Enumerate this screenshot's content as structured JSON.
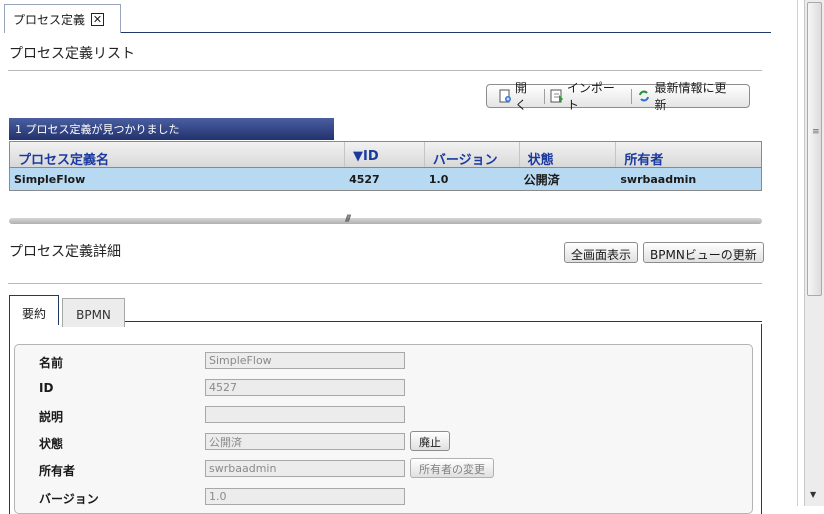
{
  "tab": {
    "title": "プロセス定義"
  },
  "list_section": {
    "title": "プロセス定義リスト"
  },
  "toolbar": {
    "open_label": "開く",
    "import_label": "インポート",
    "refresh_label": "最新情報に更新"
  },
  "result_banner": "1 プロセス定義が見つかりました",
  "table": {
    "columns": [
      "プロセス定義名",
      "▼ID",
      "バージョン",
      "状態",
      "所有者"
    ],
    "rows": [
      {
        "name": "SimpleFlow",
        "id": "4527",
        "version": "1.0",
        "status": "公開済",
        "owner": "swrbaadmin"
      }
    ]
  },
  "detail_section": {
    "title": "プロセス定義詳細",
    "fullscreen_label": "全画面表示",
    "bpmn_refresh_label": "BPMNビューの更新"
  },
  "detail_tabs": [
    "要約",
    "BPMN"
  ],
  "form": {
    "name_label": "名前",
    "name_value": "SimpleFlow",
    "id_label": "ID",
    "id_value": "4527",
    "desc_label": "説明",
    "desc_value": "",
    "status_label": "状態",
    "status_value": "公開済",
    "deprecate_label": "廃止",
    "owner_label": "所有者",
    "owner_value": "swrbaadmin",
    "change_owner_label": "所有者の変更",
    "version_label": "バージョン",
    "version_value": "1.0"
  },
  "colors": {
    "banner": "#22326e",
    "selected_row": "#b7d9f2",
    "header_text": "#1a3aa0"
  }
}
